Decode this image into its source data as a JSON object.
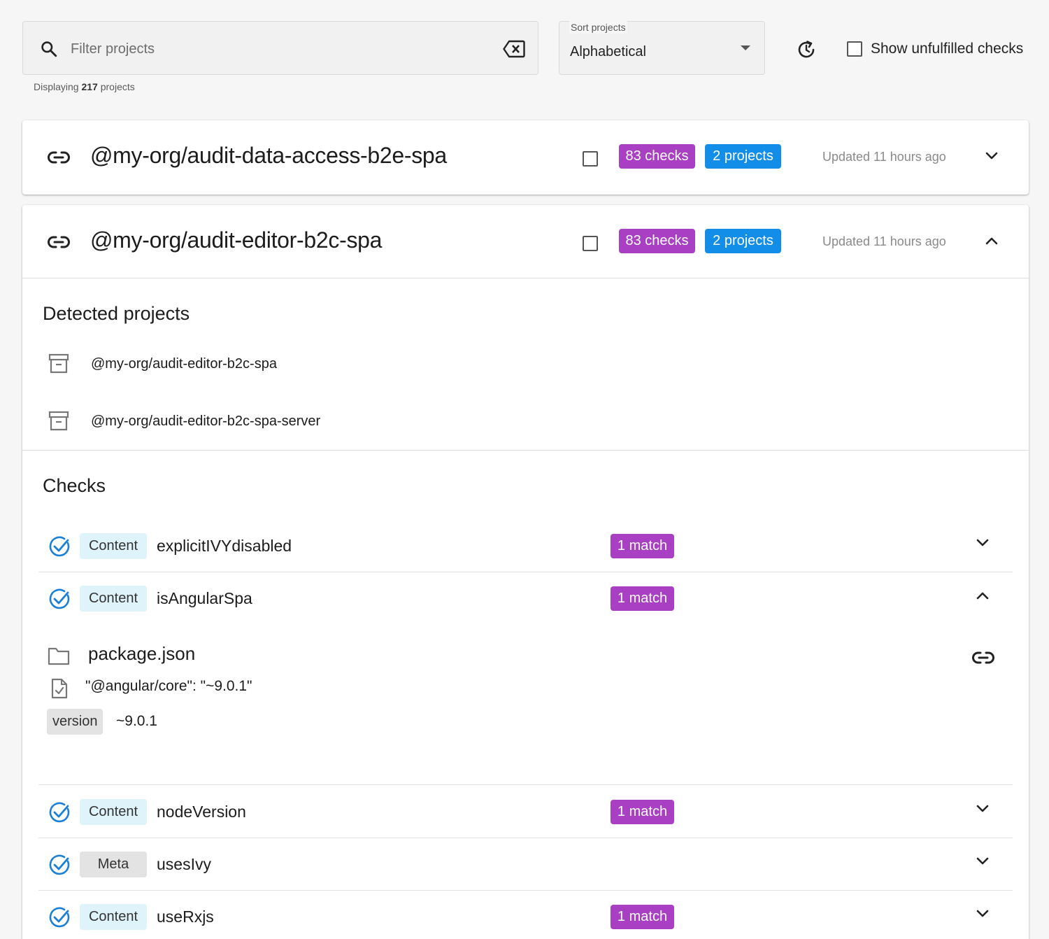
{
  "toolbar": {
    "filter_placeholder": "Filter projects",
    "count_prefix": "Displaying",
    "count_value": "217",
    "count_suffix": "projects",
    "sort_label": "Sort projects",
    "sort_value": "Alphabetical",
    "show_unfulfilled_label": "Show unfulfilled checks"
  },
  "projects": [
    {
      "name": "@my-org/audit-data-access-b2e-spa",
      "checks_badge": "83 checks",
      "projects_badge": "2 projects",
      "updated": "Updated 11 hours ago",
      "expanded": false
    },
    {
      "name": "@my-org/audit-editor-b2c-spa",
      "checks_badge": "83 checks",
      "projects_badge": "2 projects",
      "updated": "Updated 11 hours ago",
      "expanded": true,
      "detected_title": "Detected projects",
      "detected": [
        "@my-org/audit-editor-b2c-spa",
        "@my-org/audit-editor-b2c-spa-server"
      ],
      "checks_title": "Checks",
      "checks": [
        {
          "type": "Content",
          "name": "explicitIVYdisabled",
          "match": "1 match"
        },
        {
          "type": "Content",
          "name": "isAngularSpa",
          "match": "1 match"
        },
        {
          "type": "Content",
          "name": "nodeVersion",
          "match": "1 match"
        },
        {
          "type": "Meta",
          "name": "usesIvy",
          "match": ""
        },
        {
          "type": "Content",
          "name": "useRxjs",
          "match": "1 match"
        }
      ],
      "match_detail": {
        "file": "package.json",
        "snippet": "\"@angular/core\": \"~9.0.1\"",
        "capture_name": "version",
        "capture_value": "~9.0.1"
      }
    }
  ],
  "colors": {
    "purple_badge": "#a93fc3",
    "blue_badge": "#138ee8",
    "check_ok": "#1a7fd6",
    "content_tag_bg": "#dff3fb",
    "meta_tag_bg": "#e3e3e3"
  },
  "icons": {
    "search": "search-icon",
    "clear": "backspace-icon",
    "refresh": "refresh-icon",
    "link": "link-icon",
    "archive": "archive-icon",
    "check": "check-circle-icon",
    "folder": "folder-icon",
    "file": "file-check-icon",
    "chevron_down": "chevron-down-icon",
    "chevron_up": "chevron-up-icon"
  }
}
